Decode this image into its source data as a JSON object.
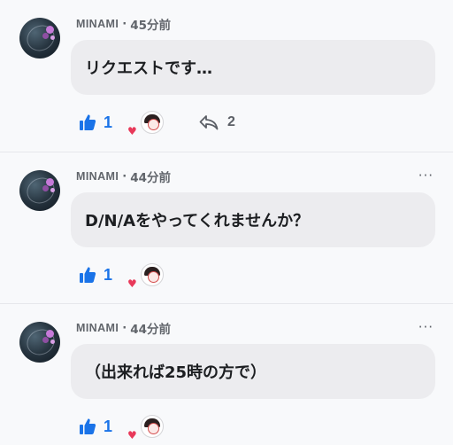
{
  "comments": [
    {
      "username": "MINAMI",
      "separator": "·",
      "time": "45分前",
      "text": "リクエストです…",
      "likes": "1",
      "replies": "2",
      "has_more": false
    },
    {
      "username": "MINAMI",
      "separator": "·",
      "time": "44分前",
      "text": "D/N/Aをやってくれませんか？",
      "likes": "1",
      "has_more": true,
      "more_label": "···"
    },
    {
      "username": "MINAMI",
      "separator": "·",
      "time": "44分前",
      "text": "（出来れば25時の方で）",
      "likes": "1",
      "has_more": true,
      "more_label": "···"
    }
  ],
  "colors": {
    "like_blue": "#1a73e8",
    "bubble": "#ececef",
    "background": "#f8f9fb",
    "heart": "#e8395a"
  },
  "icons": [
    "user-avatar",
    "thumbs-up-icon",
    "reaction-avatar",
    "heart-icon",
    "reply-icon",
    "more-options-icon"
  ]
}
